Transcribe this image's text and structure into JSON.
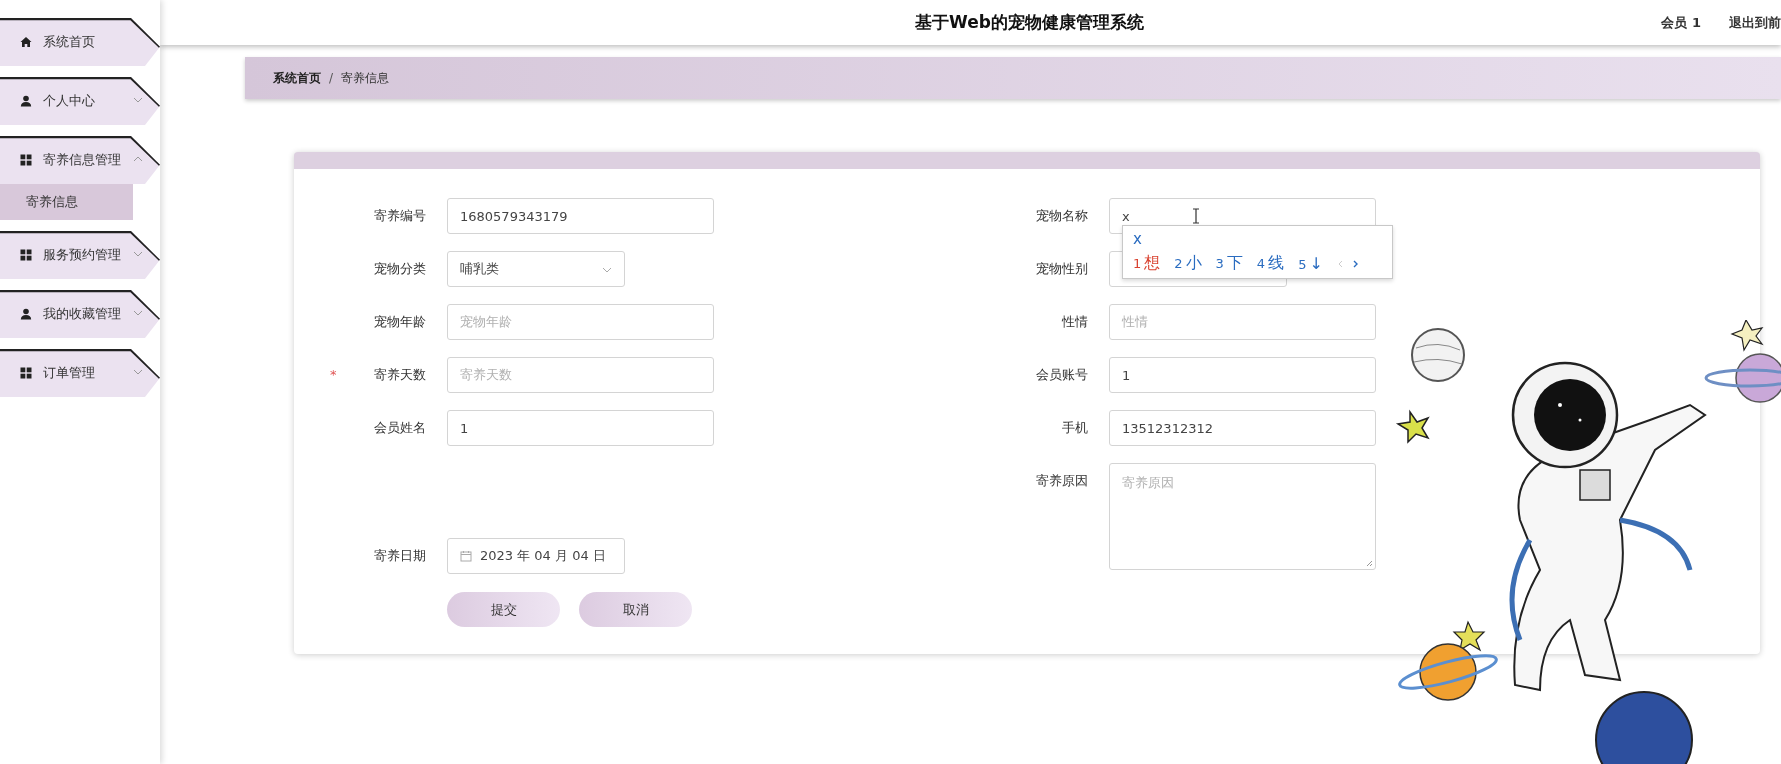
{
  "header": {
    "title": "基于Web的宠物健康管理系统",
    "user": "会员 1",
    "exit": "退出到前"
  },
  "sidebar": {
    "items": [
      {
        "label": "系统首页",
        "kind": "home"
      },
      {
        "label": "个人中心",
        "kind": "user",
        "expanded": false
      },
      {
        "label": "寄养信息管理",
        "kind": "grid",
        "expanded": true,
        "children": [
          {
            "label": "寄养信息",
            "selected": true
          }
        ]
      },
      {
        "label": "服务预约管理",
        "kind": "grid",
        "expanded": false
      },
      {
        "label": "我的收藏管理",
        "kind": "user",
        "expanded": false
      },
      {
        "label": "订单管理",
        "kind": "grid",
        "expanded": false
      }
    ]
  },
  "breadcrumb": {
    "items": [
      "系统首页",
      "寄养信息"
    ],
    "separator": "/"
  },
  "form": {
    "required_mark": "*",
    "left": [
      {
        "label": "寄养编号",
        "kind": "input",
        "value": "1680579343179",
        "required": false
      },
      {
        "label": "宠物分类",
        "kind": "select",
        "value": "哺乳类",
        "required": false
      },
      {
        "label": "宠物年龄",
        "kind": "input",
        "placeholder": "宠物年龄",
        "required": false
      },
      {
        "label": "寄养天数",
        "kind": "input",
        "placeholder": "寄养天数",
        "required": true
      },
      {
        "label": "会员姓名",
        "kind": "input",
        "value": "1",
        "required": false
      },
      {
        "label": "寄养日期",
        "kind": "date",
        "value": "2023 年 04 月 04 日",
        "required": false
      }
    ],
    "right": [
      {
        "label": "宠物名称",
        "kind": "input",
        "value": "x",
        "required": false
      },
      {
        "label": "宠物性别",
        "kind": "select",
        "required": false
      },
      {
        "label": "性情",
        "kind": "input",
        "placeholder": "性情",
        "required": false
      },
      {
        "label": "会员账号",
        "kind": "input",
        "value": "1",
        "required": false
      },
      {
        "label": "手机",
        "kind": "input",
        "value": "13512312312",
        "required": false
      },
      {
        "label": "寄养原因",
        "kind": "textarea",
        "placeholder": "寄养原因",
        "required": false
      }
    ],
    "buttons": [
      "提交",
      "取消"
    ]
  },
  "ime": {
    "composition": "x",
    "candidates": [
      {
        "number": "1",
        "text": "想",
        "selected": true
      },
      {
        "number": "2",
        "text": "小",
        "selected": false
      },
      {
        "number": "3",
        "text": "下",
        "selected": false
      },
      {
        "number": "4",
        "text": "线",
        "selected": false
      },
      {
        "number": "5",
        "text": "↓",
        "selected": false
      }
    ]
  }
}
